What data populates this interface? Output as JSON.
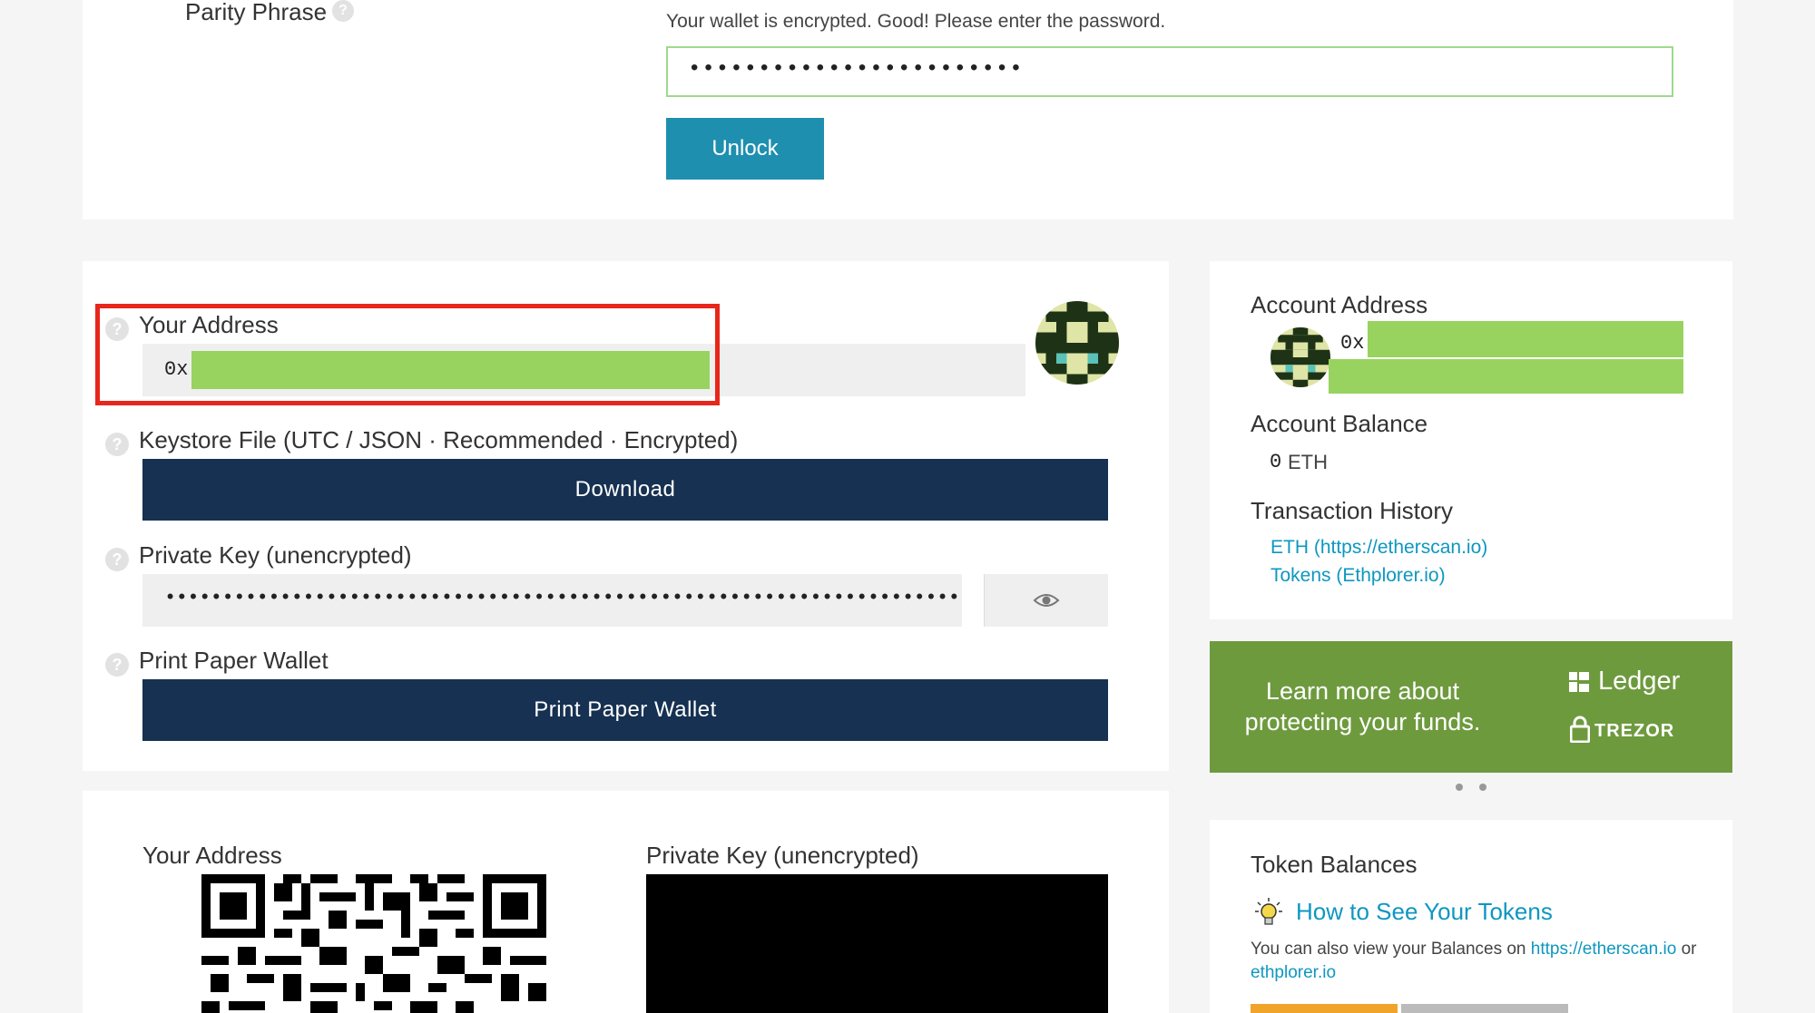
{
  "unlock": {
    "option_label": "Parity Phrase",
    "message": "Your wallet is encrypted. Good! Please enter the password.",
    "password_value": "••••••••••••••••••••••••",
    "button_label": "Unlock"
  },
  "wallet": {
    "address_label": "Your Address",
    "address_prefix": "0x",
    "keystore_label": "Keystore File (UTC / JSON · Recommended · Encrypted)",
    "download_label": "Download",
    "private_key_label": "Private Key (unencrypted)",
    "private_key_value": "•••••••••••••••••••••••••••••••••••••••••••••••••••••••••••••••••••••",
    "print_label": "Print Paper Wallet",
    "print_button": "Print Paper Wallet"
  },
  "qr_section": {
    "address_label": "Your Address",
    "private_key_label": "Private Key (unencrypted)"
  },
  "account": {
    "address_heading": "Account Address",
    "address_prefix": "0x",
    "balance_heading": "Account Balance",
    "balance_value": "0",
    "balance_unit": "ETH",
    "history_heading": "Transaction History",
    "history_links": [
      "ETH (https://etherscan.io)",
      "Tokens (Ethplorer.io)"
    ]
  },
  "promo": {
    "line1": "Learn more about",
    "line2": "protecting your funds.",
    "ledger": "Ledger",
    "trezor": "TREZOR",
    "bg_color": "#6e9a3e"
  },
  "tokens": {
    "heading": "Token Balances",
    "how_to_link": "How to See Your Tokens",
    "note_prefix": "You can also view your Balances on ",
    "note_link1": "https://etherscan.io",
    "note_mid": " or",
    "note_link2": "ethplorer.io"
  },
  "colors": {
    "accent": "#1f8fb0",
    "dark_button": "#163151",
    "highlight_red": "#e8261b",
    "redaction_green": "#98d35f"
  }
}
